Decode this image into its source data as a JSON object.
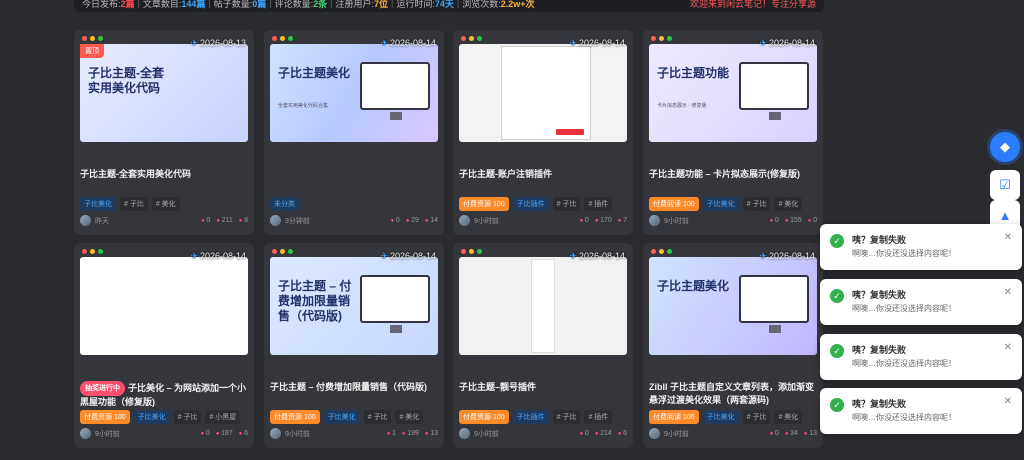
{
  "stats": {
    "today_label": "今日发布:",
    "today_value": "2篇",
    "articles_label": "文章数目:",
    "articles_value": "144篇",
    "posts_label": "帖子数量:",
    "posts_value": "0篇",
    "comments_label": "评论数量:",
    "comments_value": "2条",
    "users_label": "注册用户:",
    "users_value": "7位",
    "runtime_label": "运行时间:",
    "runtime_value": "74天",
    "views_label": "浏览次数:",
    "views_value": "2.2w+次",
    "welcome": "欢迎来到闲云笔记！专注分享源"
  },
  "cards": [
    {
      "date": "2026-08-13",
      "sticky": "置顶",
      "thumb_title": "子比主题-全套实用美化代码",
      "thumb_sub": "",
      "title": "子比主题-全套实用美化代码",
      "tags": [
        {
          "label": "子比美化",
          "kind": "cat"
        },
        {
          "label": "# 子比",
          "kind": "plain"
        },
        {
          "label": "# 美化",
          "kind": "plain"
        }
      ],
      "time": "昨天",
      "likes": "0",
      "views": "211",
      "comments": "8"
    },
    {
      "date": "2026-08-14",
      "sticky": "",
      "thumb_title": "子比主题美化",
      "thumb_sub": "全套实用美化代码合集",
      "title": "",
      "tags": [
        {
          "label": "未分类",
          "kind": "cat"
        }
      ],
      "time": "3分钟前",
      "likes": "0",
      "views": "29",
      "comments": "14"
    },
    {
      "date": "2026-08-14",
      "sticky": "",
      "thumb_title": "",
      "thumb_sub": "",
      "title": "子比主题-账户注销插件",
      "tags": [
        {
          "label": "付费资源 100",
          "kind": "pay"
        },
        {
          "label": "子比插件",
          "kind": "cat"
        },
        {
          "label": "# 子比",
          "kind": "plain"
        },
        {
          "label": "# 插件",
          "kind": "plain"
        }
      ],
      "time": "9小时前",
      "likes": "0",
      "views": "170",
      "comments": "7"
    },
    {
      "date": "2026-08-14",
      "sticky": "",
      "thumb_title": "子比主题功能",
      "thumb_sub": "卡片拟态展示 · 修复版",
      "title": "子比主题功能 – 卡片拟态展示(修复版)",
      "tags": [
        {
          "label": "付费阅读 100",
          "kind": "pay"
        },
        {
          "label": "子比美化",
          "kind": "cat"
        },
        {
          "label": "# 子比",
          "kind": "plain"
        },
        {
          "label": "# 美化",
          "kind": "plain"
        }
      ],
      "time": "9小时前",
      "likes": "0",
      "views": "155",
      "comments": "0"
    },
    {
      "date": "2026-08-14",
      "sticky": "",
      "thumb_title": "",
      "thumb_sub": "",
      "lotto": "抽奖进行中",
      "title": "子比美化 – 为网站添加一个小黑屋功能（修复版)",
      "tags": [
        {
          "label": "付费资源 100",
          "kind": "pay"
        },
        {
          "label": "子比美化",
          "kind": "cat"
        },
        {
          "label": "# 子比",
          "kind": "plain"
        },
        {
          "label": "# 小黑屋",
          "kind": "plain"
        }
      ],
      "time": "9小时前",
      "likes": "0",
      "views": "187",
      "comments": "6"
    },
    {
      "date": "2026-08-14",
      "sticky": "",
      "thumb_title": "子比主题 – 付费增加限量销售（代码版)",
      "thumb_sub": "",
      "title": "子比主题 – 付费增加限量销售（代码版)",
      "tags": [
        {
          "label": "付费资源 100",
          "kind": "pay"
        },
        {
          "label": "子比美化",
          "kind": "cat"
        },
        {
          "label": "# 子比",
          "kind": "plain"
        },
        {
          "label": "# 美化",
          "kind": "plain"
        }
      ],
      "time": "9小时前",
      "likes": "1",
      "views": "199",
      "comments": "13"
    },
    {
      "date": "2026-08-14",
      "sticky": "",
      "thumb_title": "",
      "thumb_sub": "",
      "title": "子比主题–靓号插件",
      "tags": [
        {
          "label": "付费资源 100",
          "kind": "pay"
        },
        {
          "label": "子比插件",
          "kind": "cat"
        },
        {
          "label": "# 子比",
          "kind": "plain"
        },
        {
          "label": "# 插件",
          "kind": "plain"
        }
      ],
      "time": "9小时前",
      "likes": "0",
      "views": "214",
      "comments": "6"
    },
    {
      "date": "2026-08-14",
      "sticky": "",
      "thumb_title": "子比主题美化",
      "thumb_sub": "",
      "title": "Zibll 子比主题自定义文章列表，添加渐变悬浮过渡美化效果（两套源码)",
      "tags": [
        {
          "label": "付费阅读 100",
          "kind": "pay"
        },
        {
          "label": "子比美化",
          "kind": "cat"
        },
        {
          "label": "# 子比",
          "kind": "plain"
        },
        {
          "label": "# 美化",
          "kind": "plain"
        }
      ],
      "time": "9小时前",
      "likes": "0",
      "views": "34",
      "comments": "13"
    }
  ],
  "toasts": [
    {
      "title": "咦？复制失败",
      "message": "啊噢…你没还没选择内容呢！"
    },
    {
      "title": "咦？复制失败",
      "message": "啊噢…你没还没选择内容呢！"
    },
    {
      "title": "咦？复制失败",
      "message": "啊噢…你没还没选择内容呢！"
    },
    {
      "title": "咦？复制失败",
      "message": "啊噢…你没还没选择内容呢！"
    }
  ],
  "icons": {
    "float1": "diamond-icon",
    "float2": "calendar-check-icon",
    "float3": "upload-icon"
  }
}
